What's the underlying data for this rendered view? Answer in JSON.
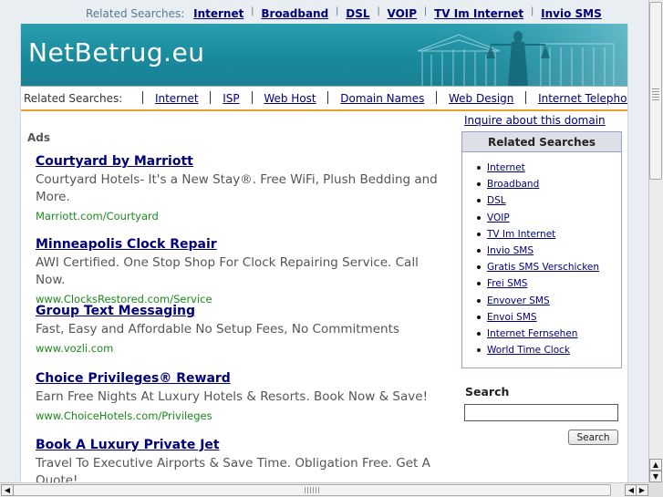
{
  "top_bar": {
    "label": "Related Searches:",
    "links": [
      "Internet",
      "Broadband",
      "DSL",
      "VOIP",
      "TV Im Internet",
      "Invio SMS"
    ]
  },
  "banner": {
    "title": "NetBetrug.eu"
  },
  "nav": {
    "label": "Related Searches:",
    "links": [
      "Internet",
      "ISP",
      "Web Host",
      "Domain Names",
      "Web Design",
      "Internet Telephony"
    ]
  },
  "ads": {
    "label": "Ads",
    "items": [
      {
        "title": "Courtyard by Marriott",
        "desc": "Courtyard Hotels- It's a New Stay®. Free WiFi, Plush Bedding and More.",
        "url": "Marriott.com/Courtyard"
      },
      {
        "title": "Minneapolis Clock Repair",
        "desc": "AWI Certified. One Stop Shop For Clock Repairing Service. Call Now.",
        "url": "www.ClocksRestored.com/Service"
      },
      {
        "title": "Group Text Messaging",
        "desc": "Fast, Easy and Affordable No Setup Fees, No Commitments",
        "url": "www.vozli.com"
      },
      {
        "title": "Choice Privileges® Reward",
        "desc": "Earn Free Nights At Luxury Hotels & Resorts. Book Now & Save!",
        "url": "www.ChoiceHotels.com/Privileges"
      },
      {
        "title": "Book A Luxury Private Jet",
        "desc": "Travel To Executive Airports & Save Time. Obligation Free. Get A Quote!",
        "url": ""
      }
    ]
  },
  "sidebar": {
    "inquire": "Inquire about this domain",
    "related_title": "Related Searches",
    "related_links": [
      "Internet",
      "Broadband",
      "DSL",
      "VOIP",
      "TV Im Internet",
      "Invio SMS",
      "Gratis SMS Verschicken",
      "Frei SMS",
      "Envover SMS",
      "Envoi SMS",
      "Internet Fernsehen",
      "World Time Clock"
    ],
    "search_label": "Search",
    "search_value": "",
    "search_button": "Search"
  },
  "colors": {
    "banner": "#188a9c",
    "nav_border": "#e6a028",
    "link": "#00007a",
    "ad_url": "#1a8a1a"
  },
  "icons": {
    "scroll_up": "arrow-up-icon",
    "scroll_down": "arrow-down-icon",
    "scroll_left": "arrow-left-icon",
    "scroll_right": "arrow-right-icon"
  }
}
